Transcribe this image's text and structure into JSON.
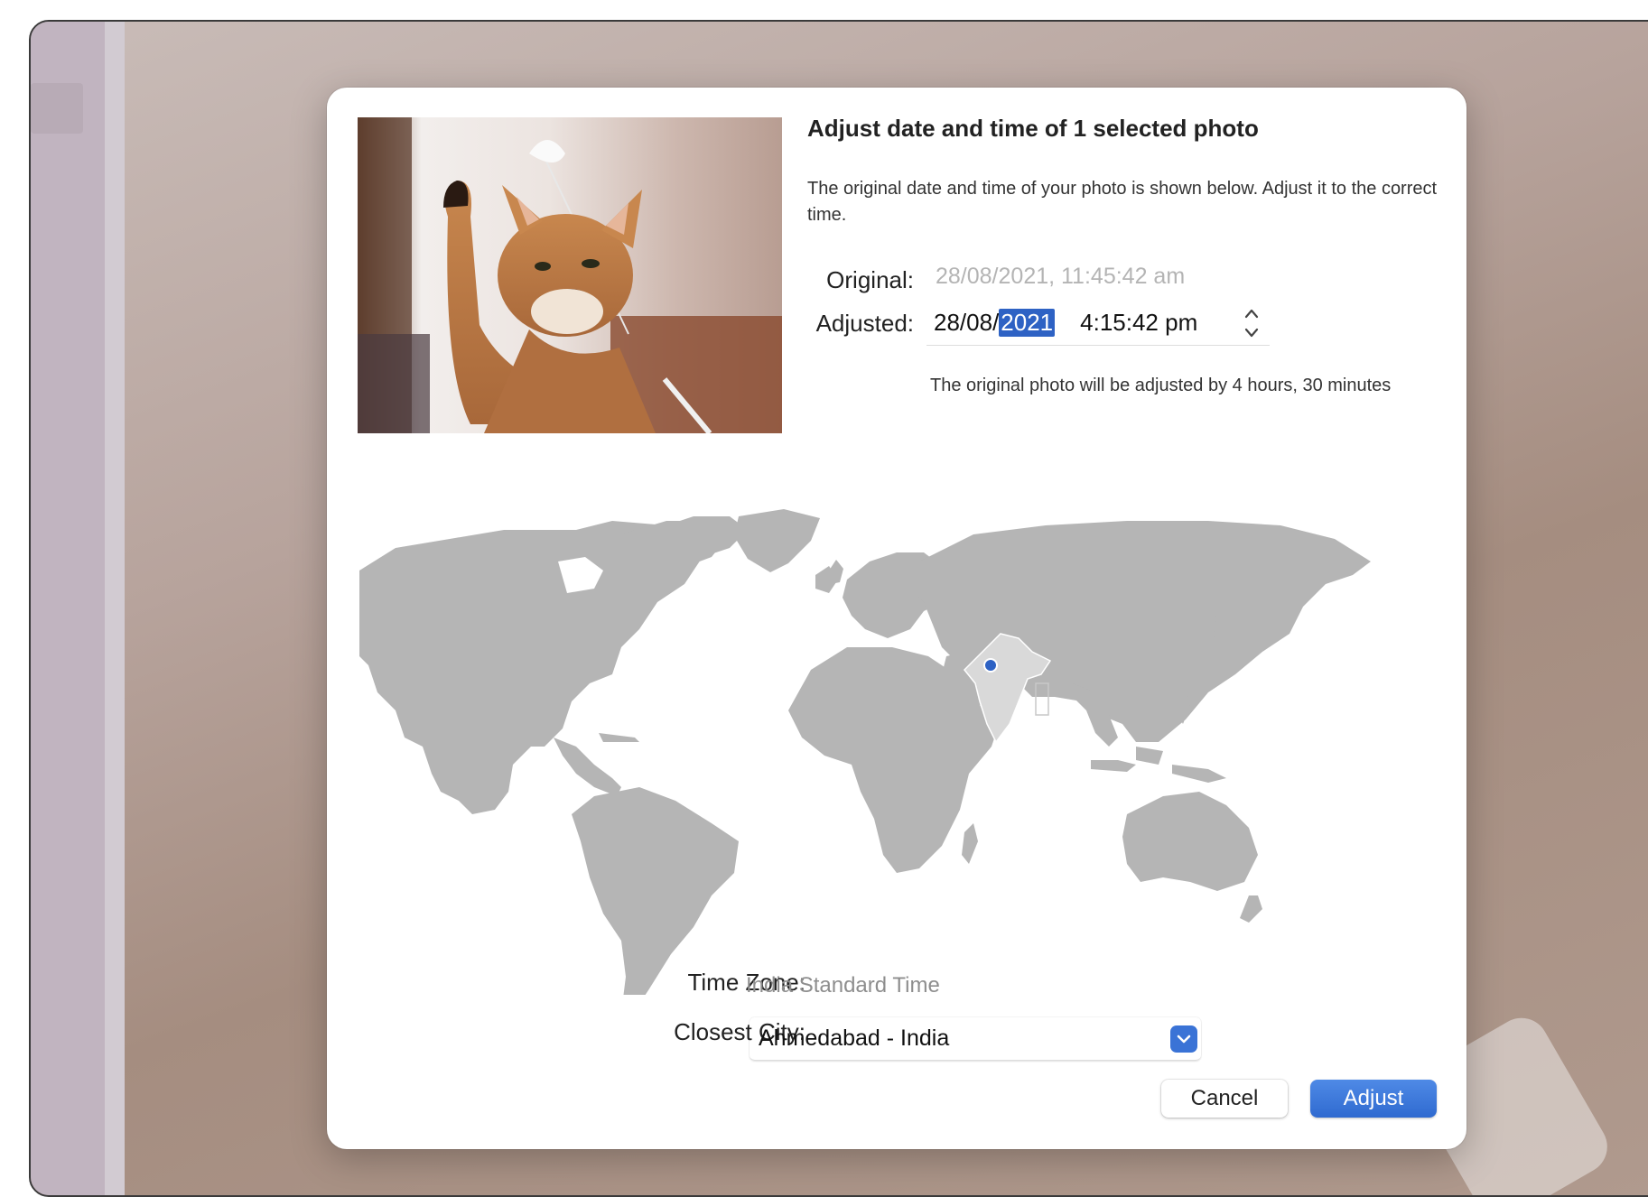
{
  "dialog": {
    "title": "Adjust date and time of 1 selected photo",
    "description": "The original date and time of your photo is shown below. Adjust it to the correct time.",
    "original_label": "Original:",
    "original_value": "28/08/2021, 11:45:42 am",
    "adjusted_label": "Adjusted:",
    "adjusted_date_prefix": "28/08/",
    "adjusted_year_selected": "2021",
    "adjusted_time": "4:15:42 pm",
    "adjust_note": "The original photo will be adjusted by 4 hours, 30 minutes",
    "timezone_label": "Time Zone:",
    "timezone_value": "India Standard Time",
    "closest_city_label": "Closest City:",
    "closest_city_value": "Ahmedabad - India",
    "cancel_label": "Cancel",
    "adjust_label": "Adjust"
  },
  "map": {
    "selected_region": "India",
    "selected_city": "Ahmedabad"
  },
  "colors": {
    "accent": "#2e62c4",
    "map_land": "#b5b5b5",
    "map_selected": "#d9d9d9",
    "pin": "#2e62c4"
  },
  "icons": {
    "stepper": "stepper-icon",
    "select_arrow": "chevron-down-icon",
    "location_pin": "location-pin-icon"
  }
}
